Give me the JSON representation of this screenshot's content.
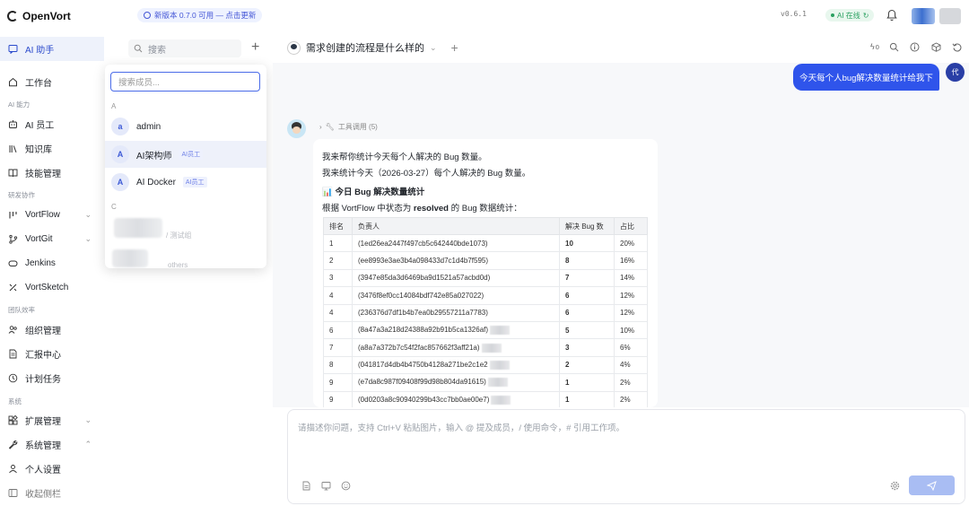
{
  "app": {
    "name": "OpenVort",
    "version": "v0.6.1",
    "update_notice": "新版本 0.7.0 可用 — 点击更新",
    "ai_status": "AI 在线"
  },
  "sidebar": {
    "active": "AI 助手",
    "top_item": "工作台",
    "sections": [
      {
        "label": "AI 能力",
        "items": [
          "AI 员工",
          "知识库",
          "技能管理"
        ]
      },
      {
        "label": "研发协作",
        "items": [
          "VortFlow",
          "VortGit",
          "Jenkins",
          "VortSketch"
        ]
      },
      {
        "label": "团队效率",
        "items": [
          "组织管理",
          "汇报中心",
          "计划任务"
        ]
      },
      {
        "label": "系统",
        "items": [
          "扩展管理",
          "系统管理",
          "个人设置",
          "收起侧栏"
        ]
      }
    ]
  },
  "members": {
    "search_placeholder": "搜索",
    "dropdown_search_placeholder": "搜索成员...",
    "group_a": "A",
    "group_c": "C",
    "rows": [
      {
        "avatar": "a",
        "name": "admin",
        "tag": ""
      },
      {
        "avatar": "A",
        "name": "AI架构师",
        "tag": "AI员工"
      },
      {
        "avatar": "A",
        "name": "AI Docker",
        "tag": "AI员工"
      }
    ],
    "blurred_1": "/ 测试组",
    "blurred_2": "others"
  },
  "chat": {
    "title": "需求创建的流程是什么样的",
    "user_message": "今天每个人bug解决数量统计给我下",
    "user_avatar": "代",
    "tool_call": "工具调用 (5)",
    "lines": [
      "我来帮你统计今天每个人解决的 Bug 数量。",
      "我来统计今天（2026-03-27）每个人解决的 Bug 数量。"
    ],
    "heading": "📊 今日 Bug 解决数量统计",
    "desc_pre": "根据 VortFlow 中状态为 ",
    "desc_bold": "resolved",
    "desc_post": " 的 Bug 数据统计：",
    "table": {
      "headers": [
        "排名",
        "负责人",
        "解决 Bug 数",
        "占比"
      ],
      "rows": [
        [
          "1",
          "(1ed26ea2447f497cb5c642440bde1073)",
          "10",
          "20%"
        ],
        [
          "2",
          "(ee8993e3ae3b4a098433d7c1d4b7f595)",
          "8",
          "16%"
        ],
        [
          "3",
          "(3947e85da3d6469ba9d1521a57acbd0d)",
          "7",
          "14%"
        ],
        [
          "4",
          "(3476f8ef0cc14084bdf742e85a027022)",
          "6",
          "12%"
        ],
        [
          "4",
          "(236376d7df1b4b7ea0b29557211a7783)",
          "6",
          "12%"
        ],
        [
          "6",
          "(8a47a3a218d24388a92b91b5ca1326af)",
          "5",
          "10%"
        ],
        [
          "7",
          "(a8a7a372b7c54f2fac857662f3aff21a)",
          "3",
          "6%"
        ],
        [
          "8",
          "(041817d4db4b4750b4128a271be2c1e2",
          "2",
          "4%"
        ],
        [
          "9",
          "(e7da8c987f09408f99d98b804da91615)",
          "1",
          "2%"
        ],
        [
          "9",
          "(0d0203a8c90940299b43cc7bb0ae00e7)",
          "1",
          "2%"
        ]
      ]
    },
    "input_placeholder": "请描述你问题，支持 Ctrl+V 粘贴图片，输入 @ 提及成员，/ 使用命令，# 引用工作项。"
  },
  "header_meta": {
    "token_count": "0"
  }
}
